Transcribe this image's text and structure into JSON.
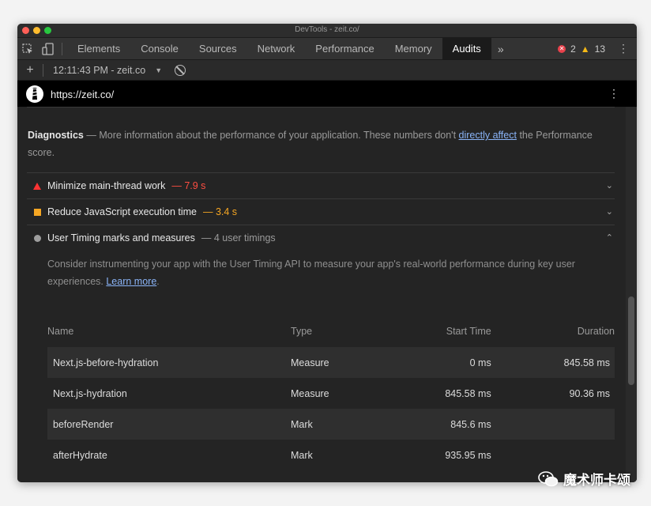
{
  "window": {
    "title": "DevTools - zeit.co/"
  },
  "tabs": [
    {
      "label": "Elements"
    },
    {
      "label": "Console"
    },
    {
      "label": "Sources"
    },
    {
      "label": "Network"
    },
    {
      "label": "Performance"
    },
    {
      "label": "Memory"
    },
    {
      "label": "Audits",
      "active": true
    }
  ],
  "toolbar": {
    "more_tabs": "»",
    "errors": "2",
    "warnings": "13"
  },
  "subbar": {
    "plus": "+",
    "report": "12:11:43 PM - zeit.co",
    "caret": "▼"
  },
  "report": {
    "url": "https://zeit.co/"
  },
  "diagnostics": {
    "title": "Diagnostics",
    "dash": "—",
    "text": "More information about the performance of your application. These numbers don't",
    "link": "directly affect",
    "text_after": "the Performance score."
  },
  "audits": [
    {
      "title": "Minimize main-thread work",
      "value": "— 7.9 s",
      "color": "#ff4e42",
      "chevron": "⌄"
    },
    {
      "title": "Reduce JavaScript execution time",
      "value": "— 3.4 s",
      "color": "#f5a623",
      "chevron": "⌄"
    },
    {
      "title": "User Timing marks and measures",
      "value": "— 4 user timings",
      "color": "#9a9a9a",
      "chevron": "⌃"
    }
  ],
  "user_timing": {
    "description": "Consider instrumenting your app with the User Timing API to measure your app's real-world performance during key user experiences.",
    "link": "Learn more",
    "link_suffix": ".",
    "columns": [
      "Name",
      "Type",
      "Start Time",
      "Duration"
    ],
    "rows": [
      {
        "name": "Next.js-before-hydration",
        "type": "Measure",
        "start": "0 ms",
        "duration": "845.58 ms"
      },
      {
        "name": "Next.js-hydration",
        "type": "Measure",
        "start": "845.58 ms",
        "duration": "90.36 ms"
      },
      {
        "name": "beforeRender",
        "type": "Mark",
        "start": "845.6 ms",
        "duration": ""
      },
      {
        "name": "afterHydrate",
        "type": "Mark",
        "start": "935.95 ms",
        "duration": ""
      }
    ]
  },
  "watermark": {
    "text": "魔术师卡颂"
  }
}
